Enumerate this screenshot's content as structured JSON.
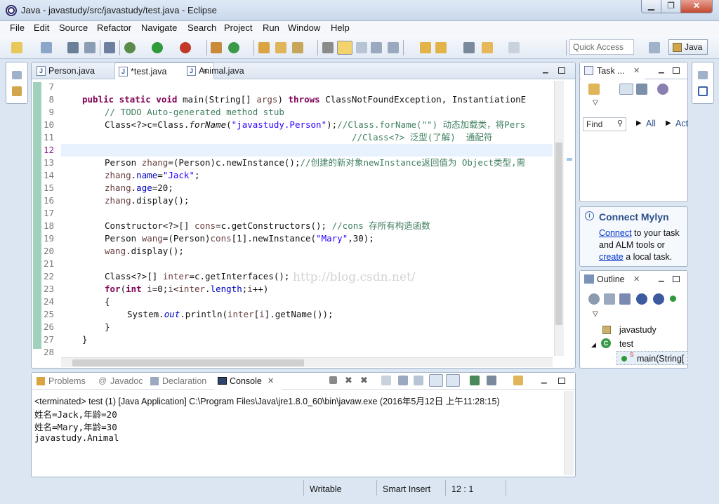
{
  "window": {
    "title": "Java - javastudy/src/javastudy/test.java - Eclipse"
  },
  "menu": [
    "File",
    "Edit",
    "Source",
    "Refactor",
    "Navigate",
    "Search",
    "Project",
    "Run",
    "Window",
    "Help"
  ],
  "toolbar": {
    "quick_access": "Quick Access",
    "perspective": "Java"
  },
  "editor": {
    "tabs": [
      {
        "label": "Person.java"
      },
      {
        "label": "*test.java"
      },
      {
        "label": "Animal.java"
      }
    ],
    "line_numbers": [
      "7",
      "8",
      "9",
      "10",
      "11",
      "12",
      "13",
      "14",
      "15",
      "16",
      "17",
      "18",
      "19",
      "20",
      "21",
      "22",
      "23",
      "24",
      "25",
      "26",
      "27",
      "28"
    ],
    "watermark": "http://blog.csdn.net/"
  },
  "task_panel": {
    "tab": "Task ...",
    "find_placeholder": "Find",
    "all": "All",
    "act": "Act"
  },
  "mylyn": {
    "title": "Connect Mylyn",
    "connect": "Connect",
    "text1": " to your task",
    "text2": "and ALM tools or",
    "create": "create",
    "text3": " a local task."
  },
  "outline": {
    "tab": "Outline",
    "package": "javastudy",
    "class": "test",
    "method": "main(String["
  },
  "bottom_tabs": [
    "Problems",
    "Javadoc",
    "Declaration",
    "Console"
  ],
  "console": {
    "header": "<terminated> test (1) [Java Application] C:\\Program Files\\Java\\jre1.8.0_60\\bin\\javaw.exe (2016年5月12日 上午11:28:15)",
    "lines": [
      "姓名=Jack,年龄=20",
      "姓名=Mary,年龄=30",
      "javastudy.Animal"
    ]
  },
  "status": {
    "writable": "Writable",
    "insert": "Smart Insert",
    "position": "12 : 1"
  }
}
